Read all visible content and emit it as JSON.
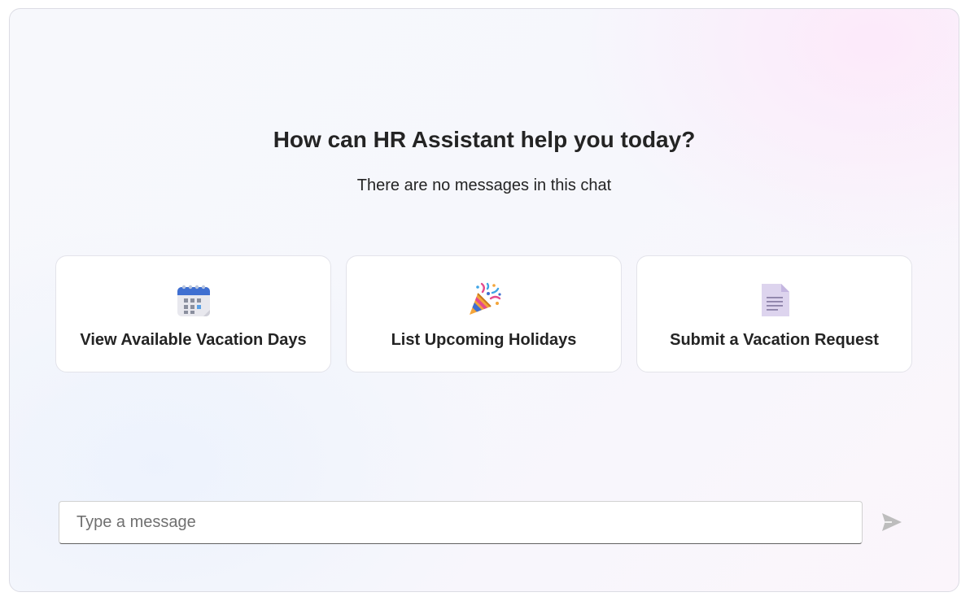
{
  "welcome": {
    "title": "How can HR Assistant help you today?",
    "subtitle": "There are no messages in this chat"
  },
  "suggestions": [
    {
      "label": "View Available Vacation Days",
      "icon": "calendar-icon"
    },
    {
      "label": "List Upcoming Holidays",
      "icon": "party-popper-icon"
    },
    {
      "label": "Submit a Vacation Request",
      "icon": "document-icon"
    }
  ],
  "composer": {
    "placeholder": "Type a message",
    "value": "",
    "send_icon": "send-icon"
  },
  "colors": {
    "text": "#242424",
    "placeholder": "#707070",
    "send_icon": "#bdbdbd",
    "card_border": "#e3e3ea"
  }
}
